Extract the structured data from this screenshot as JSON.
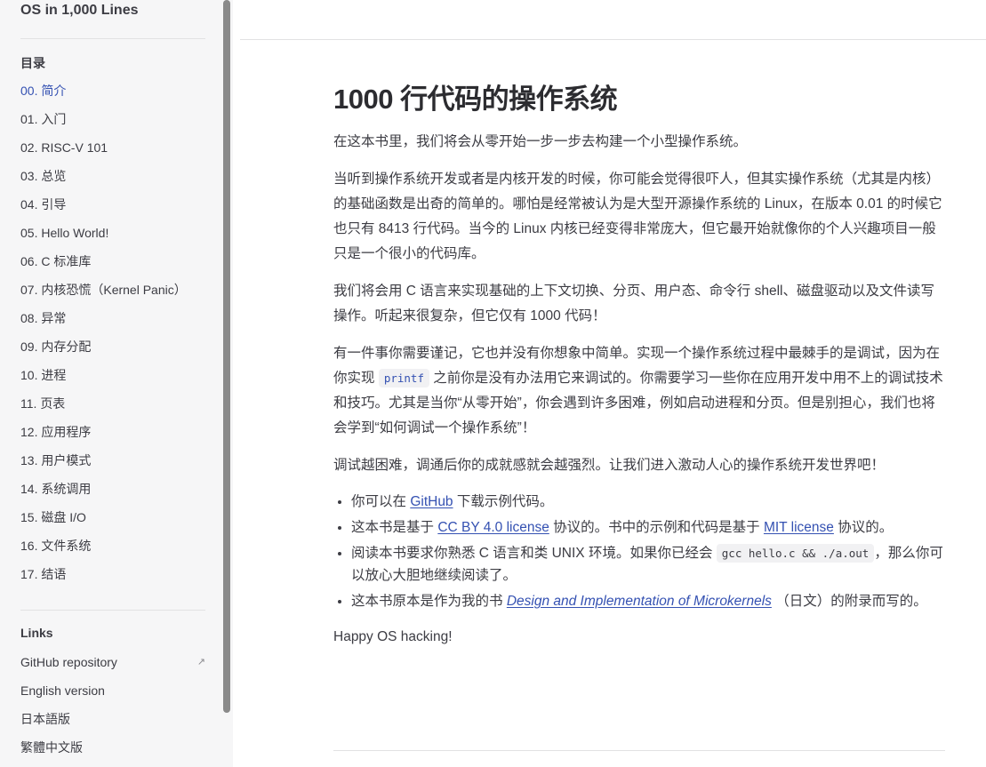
{
  "sidebar": {
    "site_title": "OS in 1,000 Lines",
    "toc_heading": "目录",
    "items": [
      {
        "label": "00. 简介"
      },
      {
        "label": "01. 入门"
      },
      {
        "label": "02. RISC-V 101"
      },
      {
        "label": "03. 总览"
      },
      {
        "label": "04. 引导"
      },
      {
        "label": "05. Hello World!"
      },
      {
        "label": "06. C 标准库"
      },
      {
        "label": "07. 内核恐慌（Kernel Panic）"
      },
      {
        "label": "08. 异常"
      },
      {
        "label": "09. 内存分配"
      },
      {
        "label": "10. 进程"
      },
      {
        "label": "11. 页表"
      },
      {
        "label": "12. 应用程序"
      },
      {
        "label": "13. 用户模式"
      },
      {
        "label": "14. 系统调用"
      },
      {
        "label": "15. 磁盘 I/O"
      },
      {
        "label": "16. 文件系统"
      },
      {
        "label": "17. 结语"
      }
    ],
    "links_heading": "Links",
    "links": [
      {
        "label": "GitHub repository",
        "icon": "external-link-icon"
      },
      {
        "label": "English version"
      },
      {
        "label": "日本語版"
      },
      {
        "label": "繁體中文版"
      }
    ]
  },
  "content": {
    "title": "1000 行代码的操作系统",
    "p1": "在这本书里，我们将会从零开始一步一步去构建一个小型操作系统。",
    "p2": "当听到操作系统开发或者是内核开发的时候，你可能会觉得很吓人，但其实操作系统（尤其是内核）的基础函数是出奇的简单的。哪怕是经常被认为是大型开源操作系统的 Linux，在版本 0.01 的时候它也只有 8413 行代码。当今的 Linux 内核已经变得非常庞大，但它最开始就像你的个人兴趣项目一般只是一个很小的代码库。",
    "p3": "我们将会用 C 语言来实现基础的上下文切换、分页、用户态、命令行 shell、磁盘驱动以及文件读写操作。听起来很复杂，但它仅有 1000 代码！",
    "p4_a": "有一件事你需要谨记，它也并没有你想象中简单。实现一个操作系统过程中最棘手的是调试，因为在你实现 ",
    "p4_code": "printf",
    "p4_b": " 之前你是没有办法用它来调试的。你需要学习一些你在应用开发中用不上的调试技术和技巧。尤其是当你“从零开始”，你会遇到许多困难，例如启动进程和分页。但是别担心，我们也将会学到“如何调试一个操作系统”！",
    "p5": "调试越困难，调通后你的成就感就会越强烈。让我们进入激动人心的操作系统开发世界吧！",
    "b1_a": "你可以在 ",
    "b1_link": "GitHub",
    "b1_b": " 下载示例代码。",
    "b2_a": "这本书是基于 ",
    "b2_link1": "CC BY 4.0 license",
    "b2_b": " 协议的。书中的示例和代码是基于 ",
    "b2_link2": "MIT license",
    "b2_c": " 协议的。",
    "b3_a": "阅读本书要求你熟悉 C 语言和类 UNIX 环境。如果你已经会 ",
    "b3_code": "gcc hello.c && ./a.out",
    "b3_b": "，那么你可以放心大胆地继续阅读了。",
    "b4_a": "这本书原本是作为我的书 ",
    "b4_link": "Design and Implementation of Microkernels",
    "b4_b": " （日文）的附录而写的。",
    "closing": "Happy OS hacking!"
  },
  "colors": {
    "accent": "#3451b2",
    "text": "#3c3c43",
    "sidebar_bg": "#f6f6f7",
    "divider": "#e2e2e3"
  }
}
